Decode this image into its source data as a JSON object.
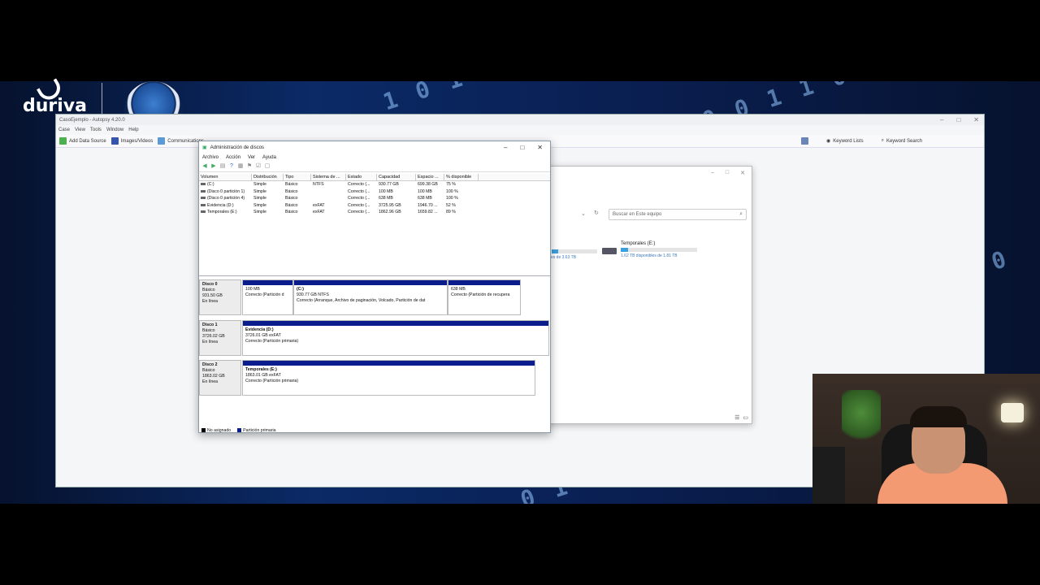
{
  "autopsy": {
    "title": "CasoEjemplo - Autopsy 4.20.0",
    "menu": [
      "Case",
      "View",
      "Tools",
      "Window",
      "Help"
    ],
    "toolbar": {
      "add_data_source": "Add Data Source",
      "images_videos": "Images/Videos",
      "communications": "Communications",
      "keyword_lists": "Keyword Lists",
      "keyword_search": "Keyword Search"
    }
  },
  "explorer": {
    "search_placeholder": "Buscar en Este equipo",
    "drive_name": "Temporales (E:)",
    "drive_free": "1.62 TB disponibles de 1.81 TB",
    "drive_usage_fraction": 0.1,
    "partial_drive_text": "ibles de 3.63 TB"
  },
  "diskmgmt": {
    "title": "Administración de discos",
    "menu": [
      "Archivo",
      "Acción",
      "Ver",
      "Ayuda"
    ],
    "columns": [
      "Volumen",
      "Distribución",
      "Tipo",
      "Sistema de ...",
      "Estado",
      "Capacidad",
      "Espacio ...",
      "% disponible"
    ],
    "volumes": [
      [
        "(C:)",
        "Simple",
        "Básico",
        "NTFS",
        "Correcto (...",
        "930.77 GB",
        "699.38 GB",
        "75 %"
      ],
      [
        "(Disco 0 partición 1)",
        "Simple",
        "Básico",
        "",
        "Correcto (...",
        "100 MB",
        "100 MB",
        "100 %"
      ],
      [
        "(Disco 0 partición 4)",
        "Simple",
        "Básico",
        "",
        "Correcto (...",
        "638 MB",
        "638 MB",
        "100 %"
      ],
      [
        "Evidencia (D:)",
        "Simple",
        "Básico",
        "exFAT",
        "Correcto (...",
        "3725.95 GB",
        "1946.70 ...",
        "52 %"
      ],
      [
        "Temporales (E:)",
        "Simple",
        "Básico",
        "exFAT",
        "Correcto (...",
        "1862.96 GB",
        "1659.82 ...",
        "89 %"
      ]
    ],
    "disks": [
      {
        "name": "Disco 0",
        "type": "Básico",
        "size": "931.50 GB",
        "status": "En línea",
        "partitions": [
          {
            "name": "",
            "line1": "100 MB",
            "line2": "Correcto (Partición d"
          },
          {
            "name": "(C:)",
            "line1": "930.77 GB NTFS",
            "line2": "Correcto (Arranque, Archivo de paginación, Volcado, Partición de dat"
          },
          {
            "name": "",
            "line1": "638 MB",
            "line2": "Correcto (Partición de recupera"
          }
        ]
      },
      {
        "name": "Disco 1",
        "type": "Básico",
        "size": "3726.02 GB",
        "status": "En línea",
        "partitions": [
          {
            "name": "Evidencia (D:)",
            "line1": "3726.01 GB exFAT",
            "line2": "Correcto (Partición primaria)"
          }
        ]
      },
      {
        "name": "Disco 2",
        "type": "Básico",
        "size": "1863.02 GB",
        "status": "En línea",
        "partitions": [
          {
            "name": "Temporales (E:)",
            "line1": "1863.01 GB exFAT",
            "line2": "Correcto (Partición primaria)"
          }
        ]
      }
    ],
    "legend": [
      "No asignado",
      "Partición primaria"
    ]
  },
  "branding": {
    "logo_text": "duriva"
  },
  "colors": {
    "primary_partition": "#0b1d8c",
    "unallocated": "#000000",
    "accent": "#3ba0e0"
  }
}
